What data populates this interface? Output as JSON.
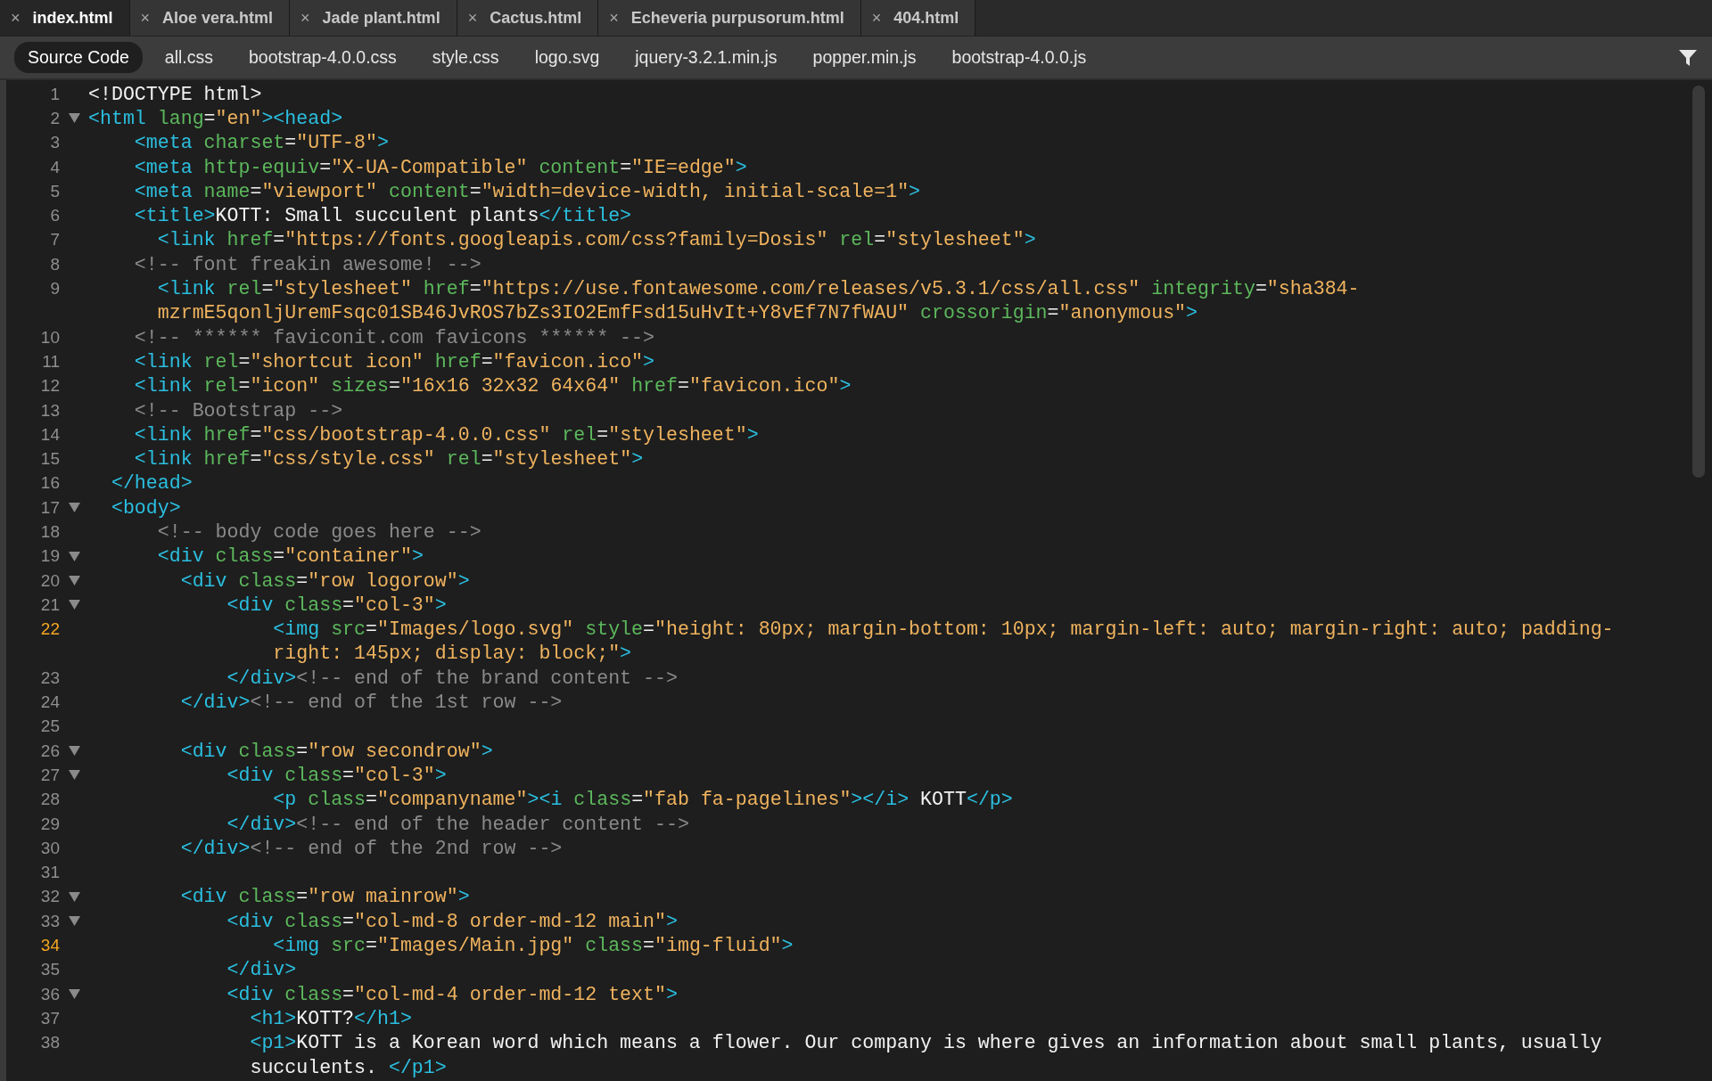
{
  "tabs": [
    {
      "label": "index.html",
      "close": "×",
      "selected": true
    },
    {
      "label": "Aloe vera.html",
      "close": "×",
      "selected": false
    },
    {
      "label": "Jade plant.html",
      "close": "×",
      "selected": false
    },
    {
      "label": "Cactus.html",
      "close": "×",
      "selected": false
    },
    {
      "label": "Echeveria purpusorum.html",
      "close": "×",
      "selected": false
    },
    {
      "label": "404.html",
      "close": "×",
      "selected": false
    }
  ],
  "related_files": [
    {
      "label": "Source Code",
      "selected": true
    },
    {
      "label": "all.css",
      "selected": false
    },
    {
      "label": "bootstrap-4.0.0.css",
      "selected": false
    },
    {
      "label": "style.css",
      "selected": false
    },
    {
      "label": "logo.svg",
      "selected": false
    },
    {
      "label": "jquery-3.2.1.min.js",
      "selected": false
    },
    {
      "label": "popper.min.js",
      "selected": false
    },
    {
      "label": "bootstrap-4.0.0.js",
      "selected": false
    }
  ],
  "lines": [
    {
      "number": "1",
      "foldable": false,
      "highlighted": false,
      "segments": [
        {
          "text": "<!DOCTYPE html>",
          "kind": "plain"
        }
      ]
    },
    {
      "number": "2",
      "foldable": true,
      "highlighted": false,
      "segments": [
        {
          "text": "<html",
          "kind": "tag"
        },
        {
          "text": " lang",
          "kind": "attr"
        },
        {
          "text": "=",
          "kind": "plain"
        },
        {
          "text": "\"en\"",
          "kind": "val"
        },
        {
          "text": "><head>",
          "kind": "tag"
        }
      ]
    },
    {
      "number": "3",
      "foldable": false,
      "highlighted": false,
      "segments": [
        {
          "text": "    <meta",
          "kind": "tag"
        },
        {
          "text": " charset",
          "kind": "attr"
        },
        {
          "text": "=",
          "kind": "plain"
        },
        {
          "text": "\"UTF-8\"",
          "kind": "val"
        },
        {
          "text": ">",
          "kind": "tag"
        }
      ]
    },
    {
      "number": "4",
      "foldable": false,
      "highlighted": false,
      "segments": [
        {
          "text": "    <meta",
          "kind": "tag"
        },
        {
          "text": " http-equiv",
          "kind": "attr"
        },
        {
          "text": "=",
          "kind": "plain"
        },
        {
          "text": "\"X-UA-Compatible\"",
          "kind": "val"
        },
        {
          "text": " content",
          "kind": "attr"
        },
        {
          "text": "=",
          "kind": "plain"
        },
        {
          "text": "\"IE=edge\"",
          "kind": "val"
        },
        {
          "text": ">",
          "kind": "tag"
        }
      ]
    },
    {
      "number": "5",
      "foldable": false,
      "highlighted": false,
      "segments": [
        {
          "text": "    <meta",
          "kind": "tag"
        },
        {
          "text": " name",
          "kind": "attr"
        },
        {
          "text": "=",
          "kind": "plain"
        },
        {
          "text": "\"viewport\"",
          "kind": "val"
        },
        {
          "text": " content",
          "kind": "attr"
        },
        {
          "text": "=",
          "kind": "plain"
        },
        {
          "text": "\"width=device-width, initial-scale=1\"",
          "kind": "val"
        },
        {
          "text": ">",
          "kind": "tag"
        }
      ]
    },
    {
      "number": "6",
      "foldable": false,
      "highlighted": false,
      "segments": [
        {
          "text": "    <title>",
          "kind": "tag"
        },
        {
          "text": "KOTT: Small succulent plants",
          "kind": "plain"
        },
        {
          "text": "</title>",
          "kind": "tag"
        }
      ]
    },
    {
      "number": "7",
      "foldable": false,
      "highlighted": false,
      "segments": [
        {
          "text": "      <link",
          "kind": "tag"
        },
        {
          "text": " href",
          "kind": "attr"
        },
        {
          "text": "=",
          "kind": "plain"
        },
        {
          "text": "\"https://fonts.googleapis.com/css?family=Dosis\"",
          "kind": "val"
        },
        {
          "text": " rel",
          "kind": "attr"
        },
        {
          "text": "=",
          "kind": "plain"
        },
        {
          "text": "\"stylesheet\"",
          "kind": "val"
        },
        {
          "text": ">",
          "kind": "tag"
        }
      ]
    },
    {
      "number": "8",
      "foldable": false,
      "highlighted": false,
      "segments": [
        {
          "text": "    <!-- font freakin awesome! -->",
          "kind": "comment"
        }
      ]
    },
    {
      "number": "9",
      "foldable": false,
      "highlighted": false,
      "segments": [
        {
          "text": "      <link",
          "kind": "tag"
        },
        {
          "text": " rel",
          "kind": "attr"
        },
        {
          "text": "=",
          "kind": "plain"
        },
        {
          "text": "\"stylesheet\"",
          "kind": "val"
        },
        {
          "text": " href",
          "kind": "attr"
        },
        {
          "text": "=",
          "kind": "plain"
        },
        {
          "text": "\"https://use.fontawesome.com/releases/v5.3.1/css/all.css\"",
          "kind": "val"
        },
        {
          "text": " integrity",
          "kind": "attr"
        },
        {
          "text": "=",
          "kind": "plain"
        },
        {
          "text": "\"sha384-",
          "kind": "val"
        }
      ],
      "continuation": [
        {
          "text": "      mzrmE5qonljUremFsqc01SB46JvROS7bZs3IO2EmfFsd15uHvIt+Y8vEf7N7fWAU\"",
          "kind": "val"
        },
        {
          "text": " crossorigin",
          "kind": "attr"
        },
        {
          "text": "=",
          "kind": "plain"
        },
        {
          "text": "\"anonymous\"",
          "kind": "val"
        },
        {
          "text": ">",
          "kind": "tag"
        }
      ]
    },
    {
      "number": "10",
      "foldable": false,
      "highlighted": false,
      "segments": [
        {
          "text": "    <!-- ****** faviconit.com favicons ****** -->",
          "kind": "comment"
        }
      ]
    },
    {
      "number": "11",
      "foldable": false,
      "highlighted": false,
      "segments": [
        {
          "text": "    <link",
          "kind": "tag"
        },
        {
          "text": " rel",
          "kind": "attr"
        },
        {
          "text": "=",
          "kind": "plain"
        },
        {
          "text": "\"shortcut icon\"",
          "kind": "val"
        },
        {
          "text": " href",
          "kind": "attr"
        },
        {
          "text": "=",
          "kind": "plain"
        },
        {
          "text": "\"favicon.ico\"",
          "kind": "val"
        },
        {
          "text": ">",
          "kind": "tag"
        }
      ]
    },
    {
      "number": "12",
      "foldable": false,
      "highlighted": false,
      "segments": [
        {
          "text": "    <link",
          "kind": "tag"
        },
        {
          "text": " rel",
          "kind": "attr"
        },
        {
          "text": "=",
          "kind": "plain"
        },
        {
          "text": "\"icon\"",
          "kind": "val"
        },
        {
          "text": " sizes",
          "kind": "attr"
        },
        {
          "text": "=",
          "kind": "plain"
        },
        {
          "text": "\"16x16 32x32 64x64\"",
          "kind": "val"
        },
        {
          "text": " href",
          "kind": "attr"
        },
        {
          "text": "=",
          "kind": "plain"
        },
        {
          "text": "\"favicon.ico\"",
          "kind": "val"
        },
        {
          "text": ">",
          "kind": "tag"
        }
      ]
    },
    {
      "number": "13",
      "foldable": false,
      "highlighted": false,
      "segments": [
        {
          "text": "    <!-- Bootstrap -->",
          "kind": "comment"
        }
      ]
    },
    {
      "number": "14",
      "foldable": false,
      "highlighted": false,
      "segments": [
        {
          "text": "    <link",
          "kind": "tag"
        },
        {
          "text": " href",
          "kind": "attr"
        },
        {
          "text": "=",
          "kind": "plain"
        },
        {
          "text": "\"css/bootstrap-4.0.0.css\"",
          "kind": "val"
        },
        {
          "text": " rel",
          "kind": "attr"
        },
        {
          "text": "=",
          "kind": "plain"
        },
        {
          "text": "\"stylesheet\"",
          "kind": "val"
        },
        {
          "text": ">",
          "kind": "tag"
        }
      ]
    },
    {
      "number": "15",
      "foldable": false,
      "highlighted": false,
      "segments": [
        {
          "text": "    <link",
          "kind": "tag"
        },
        {
          "text": " href",
          "kind": "attr"
        },
        {
          "text": "=",
          "kind": "plain"
        },
        {
          "text": "\"css/style.css\"",
          "kind": "val"
        },
        {
          "text": " rel",
          "kind": "attr"
        },
        {
          "text": "=",
          "kind": "plain"
        },
        {
          "text": "\"stylesheet\"",
          "kind": "val"
        },
        {
          "text": ">",
          "kind": "tag"
        }
      ]
    },
    {
      "number": "16",
      "foldable": false,
      "highlighted": false,
      "segments": [
        {
          "text": "  </head>",
          "kind": "tag"
        }
      ]
    },
    {
      "number": "17",
      "foldable": true,
      "highlighted": false,
      "segments": [
        {
          "text": "  <body>",
          "kind": "tag"
        }
      ]
    },
    {
      "number": "18",
      "foldable": false,
      "highlighted": false,
      "segments": [
        {
          "text": "      <!-- body code goes here -->",
          "kind": "comment"
        }
      ]
    },
    {
      "number": "19",
      "foldable": true,
      "highlighted": false,
      "segments": [
        {
          "text": "      <div",
          "kind": "tag"
        },
        {
          "text": " class",
          "kind": "attr"
        },
        {
          "text": "=",
          "kind": "plain"
        },
        {
          "text": "\"container\"",
          "kind": "val"
        },
        {
          "text": ">",
          "kind": "tag"
        }
      ]
    },
    {
      "number": "20",
      "foldable": true,
      "highlighted": false,
      "segments": [
        {
          "text": "        <div",
          "kind": "tag"
        },
        {
          "text": " class",
          "kind": "attr"
        },
        {
          "text": "=",
          "kind": "plain"
        },
        {
          "text": "\"row logorow\"",
          "kind": "val"
        },
        {
          "text": ">",
          "kind": "tag"
        }
      ]
    },
    {
      "number": "21",
      "foldable": true,
      "highlighted": false,
      "segments": [
        {
          "text": "            <div",
          "kind": "tag"
        },
        {
          "text": " class",
          "kind": "attr"
        },
        {
          "text": "=",
          "kind": "plain"
        },
        {
          "text": "\"col-3\"",
          "kind": "val"
        },
        {
          "text": ">",
          "kind": "tag"
        }
      ]
    },
    {
      "number": "22",
      "foldable": false,
      "highlighted": true,
      "segments": [
        {
          "text": "                <img",
          "kind": "tag"
        },
        {
          "text": " src",
          "kind": "attr"
        },
        {
          "text": "=",
          "kind": "plain"
        },
        {
          "text": "\"Images/logo.svg\"",
          "kind": "val"
        },
        {
          "text": " style",
          "kind": "attr"
        },
        {
          "text": "=",
          "kind": "plain"
        },
        {
          "text": "\"height: 80px; margin-bottom: 10px; margin-left: auto; margin-right: auto; padding-",
          "kind": "val"
        }
      ],
      "continuation": [
        {
          "text": "                right: 145px; display: block;\"",
          "kind": "val"
        },
        {
          "text": ">",
          "kind": "tag"
        }
      ]
    },
    {
      "number": "23",
      "foldable": false,
      "highlighted": false,
      "segments": [
        {
          "text": "            </div>",
          "kind": "tag"
        },
        {
          "text": "<!-- end of the brand content -->",
          "kind": "comment"
        }
      ]
    },
    {
      "number": "24",
      "foldable": false,
      "highlighted": false,
      "segments": [
        {
          "text": "        </div>",
          "kind": "tag"
        },
        {
          "text": "<!-- end of the 1st row -->",
          "kind": "comment"
        }
      ]
    },
    {
      "number": "25",
      "foldable": false,
      "highlighted": false
    },
    {
      "number": "26",
      "foldable": true,
      "highlighted": false,
      "segments": [
        {
          "text": "        <div",
          "kind": "tag"
        },
        {
          "text": " class",
          "kind": "attr"
        },
        {
          "text": "=",
          "kind": "plain"
        },
        {
          "text": "\"row secondrow\"",
          "kind": "val"
        },
        {
          "text": ">",
          "kind": "tag"
        }
      ]
    },
    {
      "number": "27",
      "foldable": true,
      "highlighted": false,
      "segments": [
        {
          "text": "            <div",
          "kind": "tag"
        },
        {
          "text": " class",
          "kind": "attr"
        },
        {
          "text": "=",
          "kind": "plain"
        },
        {
          "text": "\"col-3\"",
          "kind": "val"
        },
        {
          "text": ">",
          "kind": "tag"
        }
      ]
    },
    {
      "number": "28",
      "foldable": false,
      "highlighted": false,
      "segments": [
        {
          "text": "                <p",
          "kind": "tag"
        },
        {
          "text": " class",
          "kind": "attr"
        },
        {
          "text": "=",
          "kind": "plain"
        },
        {
          "text": "\"companyname\"",
          "kind": "val"
        },
        {
          "text": "><i",
          "kind": "tag"
        },
        {
          "text": " class",
          "kind": "attr"
        },
        {
          "text": "=",
          "kind": "plain"
        },
        {
          "text": "\"fab fa-pagelines\"",
          "kind": "val"
        },
        {
          "text": "></i>",
          "kind": "tag"
        },
        {
          "text": " KOTT",
          "kind": "plain"
        },
        {
          "text": "</p>",
          "kind": "tag"
        }
      ]
    },
    {
      "number": "29",
      "foldable": false,
      "highlighted": false,
      "segments": [
        {
          "text": "            </div>",
          "kind": "tag"
        },
        {
          "text": "<!-- end of the header content -->",
          "kind": "comment"
        }
      ]
    },
    {
      "number": "30",
      "foldable": false,
      "highlighted": false,
      "segments": [
        {
          "text": "        </div>",
          "kind": "tag"
        },
        {
          "text": "<!-- end of the 2nd row -->",
          "kind": "comment"
        }
      ]
    },
    {
      "number": "31",
      "foldable": false,
      "highlighted": false
    },
    {
      "number": "32",
      "foldable": true,
      "highlighted": false,
      "segments": [
        {
          "text": "        <div",
          "kind": "tag"
        },
        {
          "text": " class",
          "kind": "attr"
        },
        {
          "text": "=",
          "kind": "plain"
        },
        {
          "text": "\"row mainrow\"",
          "kind": "val"
        },
        {
          "text": ">",
          "kind": "tag"
        }
      ]
    },
    {
      "number": "33",
      "foldable": true,
      "highlighted": false,
      "segments": [
        {
          "text": "            <div",
          "kind": "tag"
        },
        {
          "text": " class",
          "kind": "attr"
        },
        {
          "text": "=",
          "kind": "plain"
        },
        {
          "text": "\"col-md-8 order-md-12 main\"",
          "kind": "val"
        },
        {
          "text": ">",
          "kind": "tag"
        }
      ]
    },
    {
      "number": "34",
      "foldable": false,
      "highlighted": true,
      "segments": [
        {
          "text": "                <img",
          "kind": "tag"
        },
        {
          "text": " src",
          "kind": "attr"
        },
        {
          "text": "=",
          "kind": "plain"
        },
        {
          "text": "\"Images/Main.jpg\"",
          "kind": "val"
        },
        {
          "text": " class",
          "kind": "attr"
        },
        {
          "text": "=",
          "kind": "plain"
        },
        {
          "text": "\"img-fluid\"",
          "kind": "val"
        },
        {
          "text": ">",
          "kind": "tag"
        }
      ]
    },
    {
      "number": "35",
      "foldable": false,
      "highlighted": false,
      "segments": [
        {
          "text": "            </div>",
          "kind": "tag"
        }
      ]
    },
    {
      "number": "36",
      "foldable": true,
      "highlighted": false,
      "segments": [
        {
          "text": "            <div",
          "kind": "tag"
        },
        {
          "text": " class",
          "kind": "attr"
        },
        {
          "text": "=",
          "kind": "plain"
        },
        {
          "text": "\"col-md-4 order-md-12 text\"",
          "kind": "val"
        },
        {
          "text": ">",
          "kind": "tag"
        }
      ]
    },
    {
      "number": "37",
      "foldable": false,
      "highlighted": false,
      "segments": [
        {
          "text": "              <h1>",
          "kind": "tag"
        },
        {
          "text": "KOTT?",
          "kind": "plain"
        },
        {
          "text": "</h1>",
          "kind": "tag"
        }
      ]
    },
    {
      "number": "38",
      "foldable": false,
      "highlighted": false,
      "segments": [
        {
          "text": "              <p1>",
          "kind": "tag"
        },
        {
          "text": "KOTT is a Korean word which means a flower. Our company is where gives an information about small plants, usually",
          "kind": "plain"
        }
      ],
      "continuation": [
        {
          "text": "              succulents. ",
          "kind": "plain"
        },
        {
          "text": "</p1>",
          "kind": "tag"
        }
      ]
    }
  ]
}
